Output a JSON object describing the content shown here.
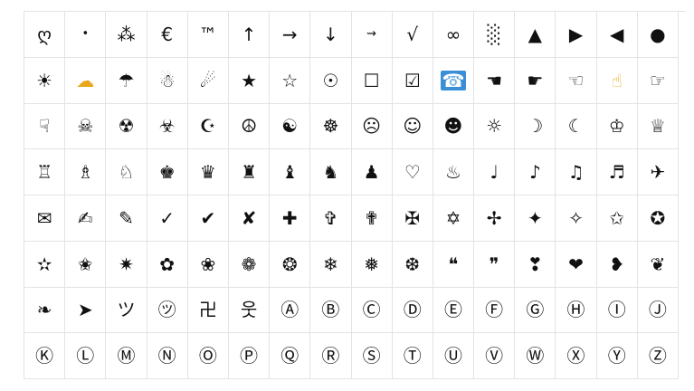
{
  "symbols": [
    "ღ",
    "•",
    "⁂",
    "€",
    "™",
    "↑",
    "→",
    "↓",
    "⇝",
    "√",
    "∞",
    "░",
    "▲",
    "▶",
    "◀",
    "●",
    "☀",
    "☁",
    "☂",
    "☃",
    "☄",
    "★",
    "☆",
    "☉",
    "☐",
    "☑",
    "☎",
    "☚",
    "☛",
    "☜",
    "☝",
    "☞",
    "☟",
    "☠",
    "☢",
    "☣",
    "☪",
    "☮",
    "☯",
    "☸",
    "☹",
    "☺",
    "☻",
    "☼",
    "☽",
    "☾",
    "♔",
    "♕",
    "♖",
    "♗",
    "♘",
    "♚",
    "♛",
    "♜",
    "♝",
    "♞",
    "♟",
    "♡",
    "♨",
    "♩",
    "♪",
    "♫",
    "♬",
    "✈",
    "✉",
    "✍",
    "✎",
    "✓",
    "✔",
    "✘",
    "✚",
    "✞",
    "✟",
    "✠",
    "✡",
    "✢",
    "✦",
    "✧",
    "✩",
    "✪",
    "✫",
    "✬",
    "✷",
    "✿",
    "❀",
    "❁",
    "❂",
    "❄",
    "❅",
    "❆",
    "❝",
    "❞",
    "❣",
    "❤",
    "❥",
    "❦",
    "❧",
    "➤",
    "ツ",
    "㋡",
    "卍",
    "웃",
    "Ⓐ",
    "Ⓑ",
    "Ⓒ",
    "Ⓓ",
    "Ⓔ",
    "Ⓕ",
    "Ⓖ",
    "Ⓗ",
    "Ⓘ",
    "Ⓙ",
    "Ⓚ",
    "Ⓛ",
    "Ⓜ",
    "Ⓝ",
    "Ⓞ",
    "Ⓟ",
    "Ⓠ",
    "Ⓡ",
    "Ⓢ",
    "Ⓣ",
    "Ⓤ",
    "Ⓥ",
    "Ⓦ",
    "Ⓧ",
    "Ⓨ",
    "Ⓩ"
  ],
  "highlight": {
    "selected_index": 26,
    "selected_color": "#3a8fd6",
    "yellow_indices": [
      17,
      30
    ],
    "yellow_color": "#e9a81b"
  }
}
